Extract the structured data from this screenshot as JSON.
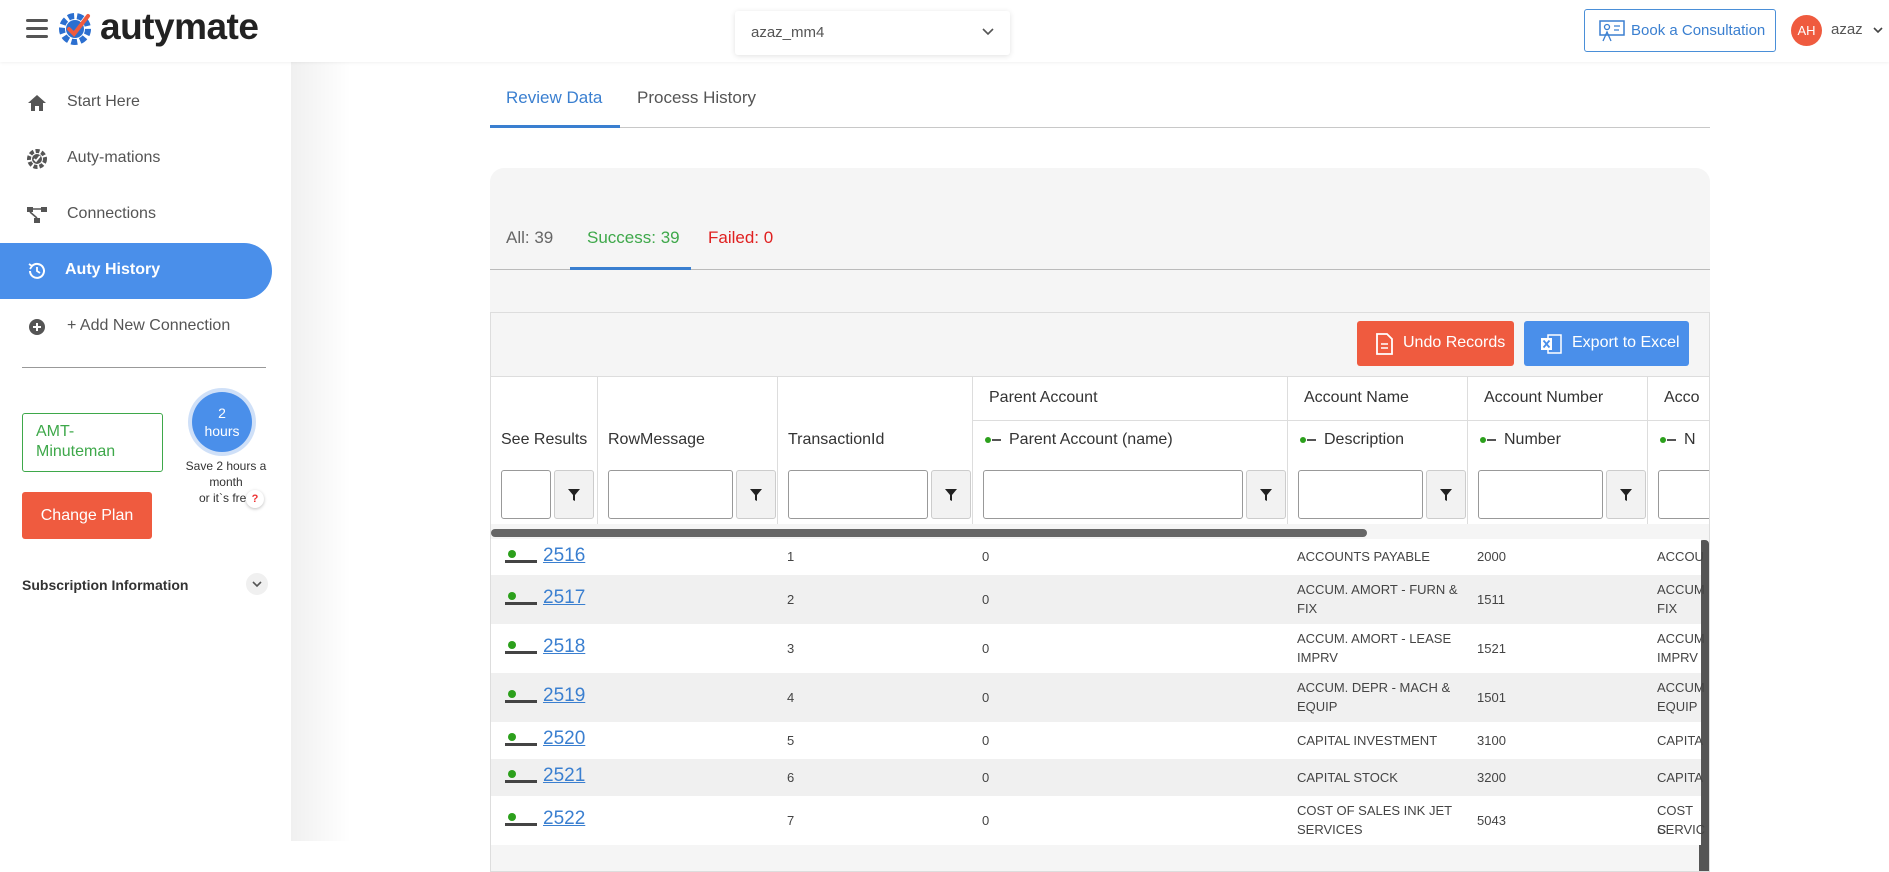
{
  "header": {
    "logo_text": "autymate",
    "workspace_value": "azaz_mm4",
    "consult_label": "Book a Consultation",
    "avatar_initials": "AH",
    "username": "azaz"
  },
  "sidebar": {
    "items": [
      {
        "label": "Start Here",
        "icon": "home-icon"
      },
      {
        "label": "Auty-mations",
        "icon": "gear-check-icon"
      },
      {
        "label": "Connections",
        "icon": "connections-icon"
      },
      {
        "label": "Auty History",
        "icon": "history-icon"
      },
      {
        "label": "+ Add New Connection",
        "icon": "plus-circle-icon"
      }
    ],
    "plan_name": "AMT-Minuteman",
    "hours_value": "2",
    "hours_unit": "hours",
    "save_text_1": "Save 2 hours a month",
    "save_text_2": "or it`s free",
    "help_mark": "?",
    "change_plan_label": "Change Plan",
    "subscription_label": "Subscription Information"
  },
  "main": {
    "tabs": [
      "Review Data",
      "Process History"
    ],
    "status": {
      "all": "All: 39",
      "success": "Success: 39",
      "failed": "Failed: 0"
    },
    "undo_label": "Undo Records",
    "export_label": "Export to Excel",
    "group_headers": {
      "parent": "Parent Account",
      "acct_name": "Account Name",
      "acct_number": "Account Number",
      "acc": "Acco"
    },
    "columns": {
      "see_results": "See Results",
      "row_message": "RowMessage",
      "transaction_id": "TransactionId",
      "parent_name": "Parent Account (name)",
      "description": "Description",
      "number": "Number",
      "n": "N"
    },
    "rows": [
      {
        "result": "2516",
        "txn": "1",
        "parent": "0",
        "desc1": "ACCOUNTS PAYABLE",
        "desc2": "",
        "number": "2000",
        "extra1": "ACCOU",
        "extra2": ""
      },
      {
        "result": "2517",
        "txn": "2",
        "parent": "0",
        "desc1": "ACCUM. AMORT - FURN &",
        "desc2": "FIX",
        "number": "1511",
        "extra1": "ACCUM",
        "extra2": "FIX"
      },
      {
        "result": "2518",
        "txn": "3",
        "parent": "0",
        "desc1": "ACCUM. AMORT - LEASE",
        "desc2": "IMPRV",
        "number": "1521",
        "extra1": "ACCUM",
        "extra2": "IMPRV"
      },
      {
        "result": "2519",
        "txn": "4",
        "parent": "0",
        "desc1": "ACCUM. DEPR - MACH &",
        "desc2": "EQUIP",
        "number": "1501",
        "extra1": "ACCUM",
        "extra2": "EQUIP"
      },
      {
        "result": "2520",
        "txn": "5",
        "parent": "0",
        "desc1": "CAPITAL INVESTMENT",
        "desc2": "",
        "number": "3100",
        "extra1": "CAPITA",
        "extra2": ""
      },
      {
        "result": "2521",
        "txn": "6",
        "parent": "0",
        "desc1": "CAPITAL STOCK",
        "desc2": "",
        "number": "3200",
        "extra1": "CAPITA",
        "extra2": ""
      },
      {
        "result": "2522",
        "txn": "7",
        "parent": "0",
        "desc1": "COST OF SALES INK JET",
        "desc2": "SERVICES",
        "number": "5043",
        "extra1": "COST C",
        "extra2": "SERVIC"
      }
    ]
  },
  "colors": {
    "accent": "#4a8fea",
    "danger": "#ef5b3f",
    "success": "#3ea84a",
    "failed": "#e02020"
  }
}
